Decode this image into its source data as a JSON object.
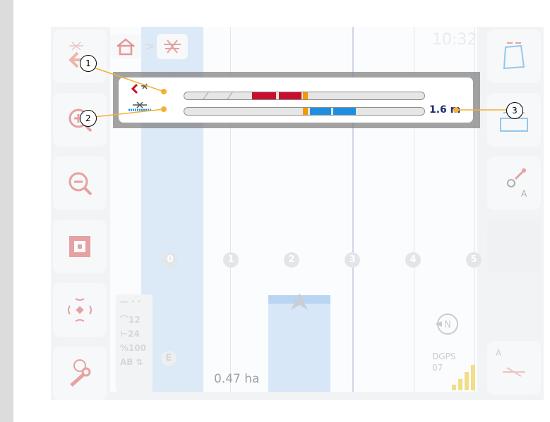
{
  "header": {
    "clock": "10:32",
    "breadcrumb_separator": ">",
    "home_icon": "home-icon",
    "section_icon": "implement-icon"
  },
  "left_buttons": [
    {
      "name": "back-button",
      "icon": "back-arrow-icon"
    },
    {
      "name": "zoom-in-button",
      "icon": "zoom-in-icon"
    },
    {
      "name": "zoom-out-button",
      "icon": "zoom-out-icon"
    },
    {
      "name": "fit-view-button",
      "icon": "fit-view-icon"
    },
    {
      "name": "gps-button",
      "icon": "satellite-icon"
    },
    {
      "name": "settings-button",
      "icon": "wrench-icon"
    }
  ],
  "right_buttons": [
    {
      "name": "field-boundary-button",
      "icon": "boundary-icon"
    },
    {
      "name": "headland-button",
      "icon": "headland-icon"
    },
    {
      "name": "set-point-a-button",
      "icon": "point-a-icon",
      "letter": "A"
    },
    {
      "name": "empty-slot",
      "icon": ""
    },
    {
      "name": "ab-line-button",
      "icon": "ab-line-icon",
      "letter": "A"
    }
  ],
  "lightbar": {
    "distance": "1.6 m",
    "steering_direction": "left",
    "top_bar_red_segments": 2,
    "bottom_bar_blue_segments": 2,
    "colors": {
      "red": "#c8102e",
      "blue": "#1e8fe0",
      "orange": "#f29a00",
      "distance_text": "#1f2d6b"
    }
  },
  "callouts": [
    "1",
    "2",
    "3"
  ],
  "track_numbers": [
    "0",
    "1",
    "2",
    "3",
    "4",
    "5"
  ],
  "status": {
    "section_count": "12",
    "working_width": "24",
    "rate": "100",
    "ab_label": "AB",
    "area": "0.47 ha",
    "gps_mode": "DGPS",
    "satellites": "07",
    "compass_label": "N",
    "edge_letter": "E"
  }
}
